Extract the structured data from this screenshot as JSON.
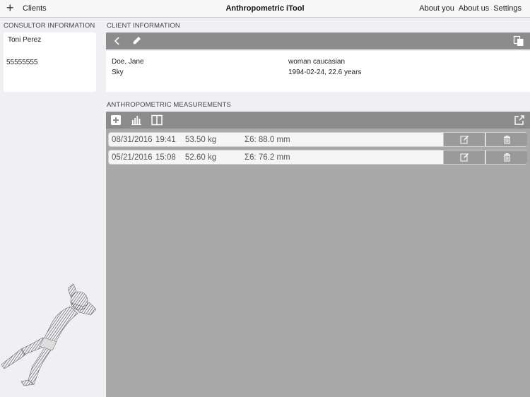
{
  "topbar": {
    "add_icon": "plus-icon",
    "clients_label": "Clients",
    "title": "Anthropometric iTool",
    "nav": [
      "About you",
      "About us",
      "Settings"
    ]
  },
  "consultor": {
    "section_label": "CONSULTOR INFORMATION",
    "name": "Toni Perez",
    "phone": "55555555"
  },
  "client": {
    "section_label": "CLIENT INFORMATION",
    "toolbar_icons": [
      "chevron-left-icon",
      "pencil-icon",
      "copy-icon"
    ],
    "name": "Doe, Jane",
    "description": "woman caucasian",
    "sport": "Sky",
    "birth_age": "1994-02-24,  22.6 years"
  },
  "measurements": {
    "section_label": "ANTHROPOMETRIC MEASUREMENTS",
    "toolbar_icons": [
      "add-square-icon",
      "bar-chart-icon",
      "split-view-icon",
      "export-icon"
    ],
    "rows": [
      {
        "date": "08/31/2016",
        "time": "19:41",
        "weight": "53.50 kg",
        "sum": "Σ6: 88.0 mm"
      },
      {
        "date": "05/21/2016",
        "time": "15:08",
        "weight": "52.60 kg",
        "sum": "Σ6: 76.2 mm"
      }
    ]
  },
  "colors": {
    "toolbar": "#8c8c8c",
    "content_bg": "#a8a8a8",
    "page_bg": "#efeff4"
  }
}
